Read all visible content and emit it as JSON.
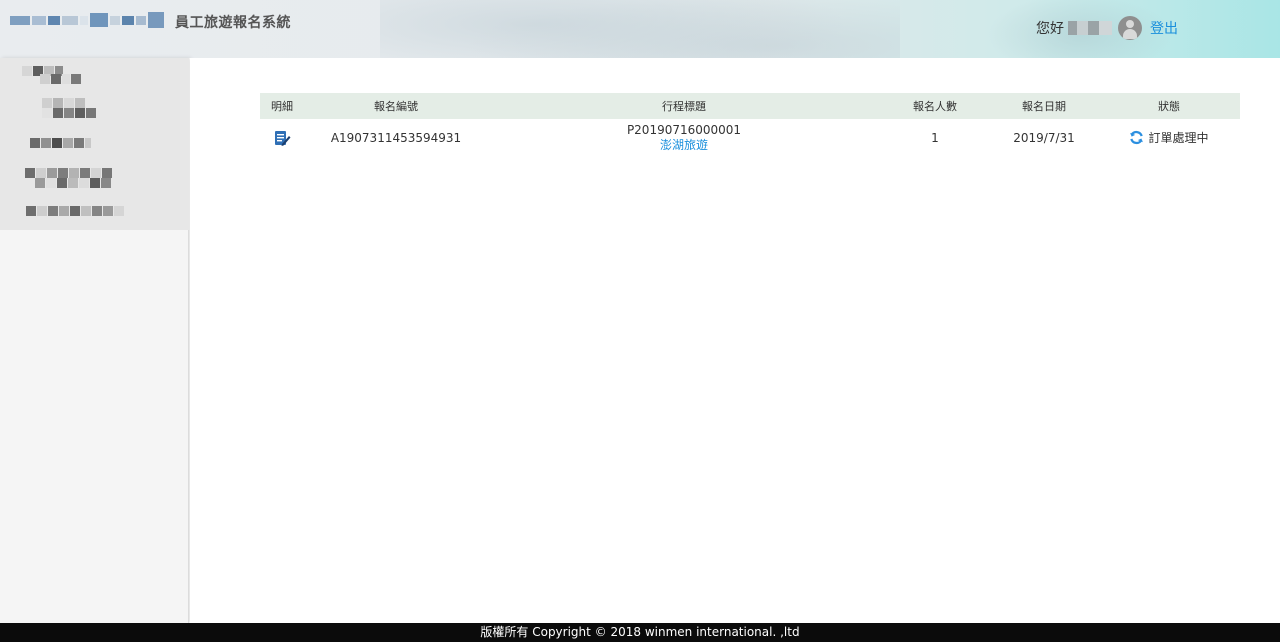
{
  "header": {
    "app_title": "員工旅遊報名系統",
    "greeting": "您好",
    "logout_label": "登出"
  },
  "table": {
    "headers": {
      "detail": "明細",
      "order_id": "報名編號",
      "trip_title": "行程標題",
      "participants": "報名人數",
      "signup_date": "報名日期",
      "status": "狀態"
    },
    "rows": [
      {
        "order_id": "A1907311453594931",
        "trip_code": "P20190716000001",
        "trip_name": "澎湖旅遊",
        "participants": "1",
        "signup_date": "2019/7/31",
        "status": "訂單處理中"
      }
    ]
  },
  "footer": {
    "copyright": "版權所有 Copyright © 2018 winmen international. ,ltd"
  },
  "colors": {
    "accent_link": "#1a8fdc",
    "table_header_bg": "#e4ede6",
    "footer_bg": "#0b0b0b",
    "sidebar_bg": "#e7e7e7"
  },
  "icons": {
    "detail": "edit-document-icon",
    "status": "refresh-icon",
    "user": "user-avatar-icon"
  }
}
